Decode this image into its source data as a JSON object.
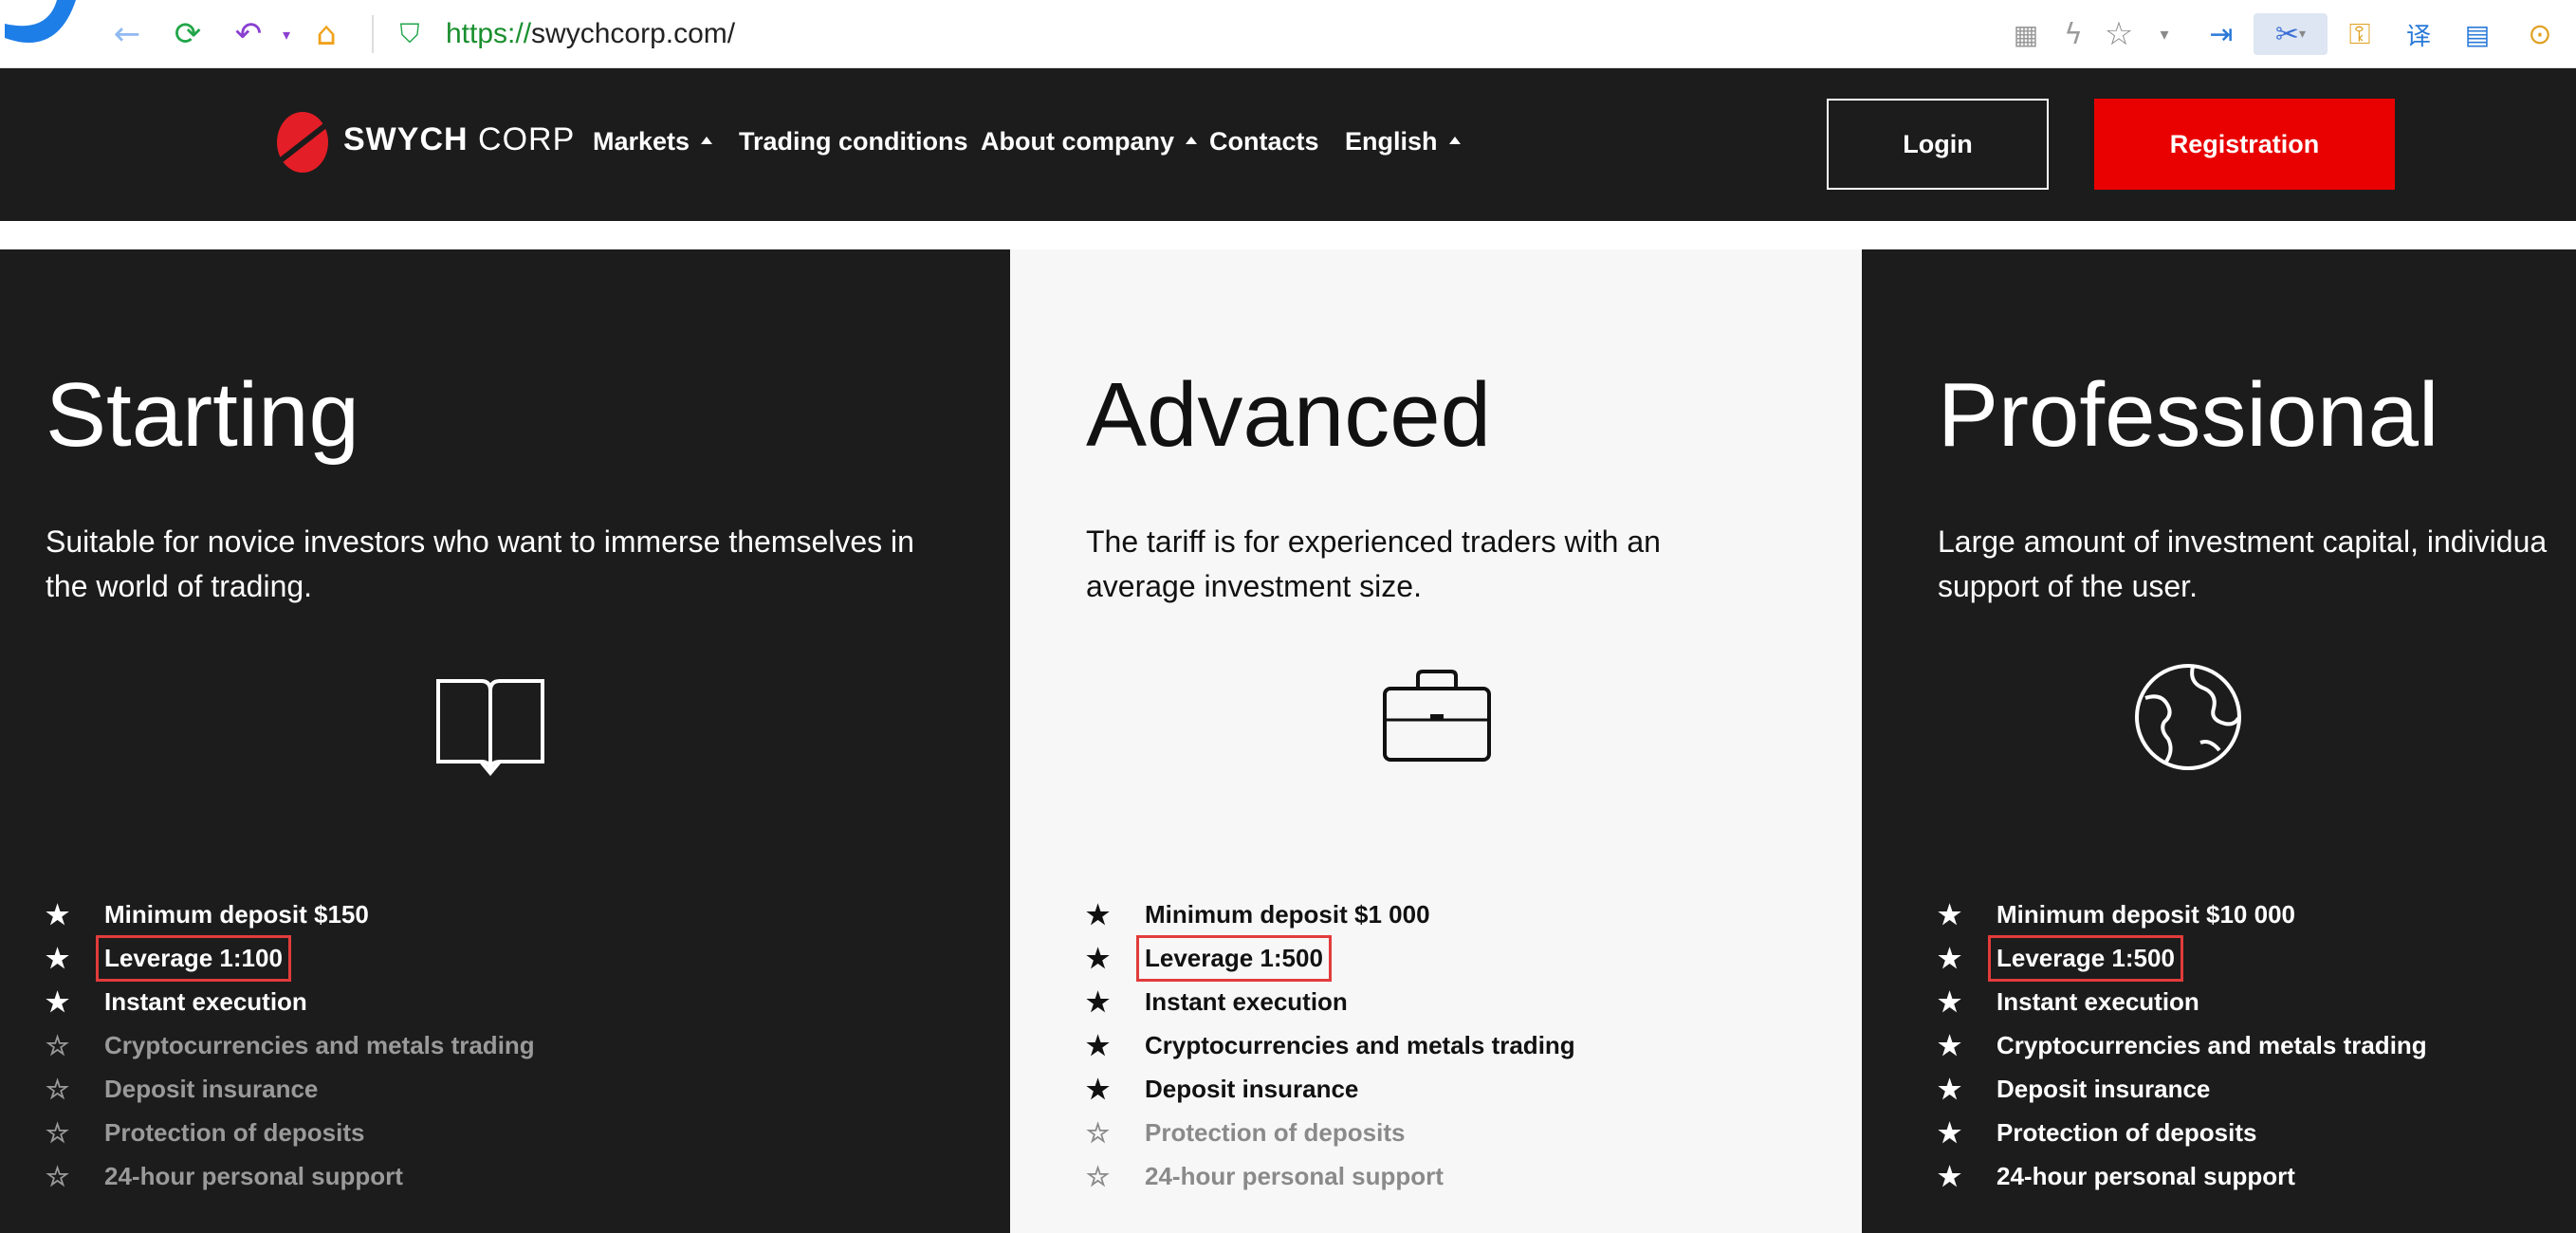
{
  "browser": {
    "url_scheme": "https://",
    "url_rest": "swychcorp.com/",
    "icons": [
      "browser-logo-icon",
      "back-icon",
      "reload-icon",
      "undo-icon",
      "home-icon",
      "shield-icon",
      "qr-icon",
      "lightning-icon",
      "star-icon",
      "dropdown-icon",
      "login-arrow-icon",
      "scissors-icon",
      "key-icon",
      "translate-icon",
      "reader-icon",
      "more-icon"
    ]
  },
  "header": {
    "logo_bold": "SWYCH",
    "logo_light": " CORP",
    "nav": [
      {
        "label": "Markets",
        "caret": true
      },
      {
        "label": "Trading conditions",
        "caret": false
      },
      {
        "label": "About company",
        "caret": true
      },
      {
        "label": "Contacts",
        "caret": false
      },
      {
        "label": "English",
        "caret": true
      }
    ],
    "login_label": "Login",
    "registration_label": "Registration"
  },
  "plans": [
    {
      "title": "Starting",
      "description": "Suitable for novice investors who want to immerse themselves in the world of trading.",
      "icon": "book-icon",
      "features": [
        {
          "label": "Minimum deposit  $150",
          "included": true
        },
        {
          "label": "Leverage 1:100",
          "included": true,
          "highlighted": true
        },
        {
          "label": "Instant execution",
          "included": true
        },
        {
          "label": "Cryptocurrencies and metals trading",
          "included": false
        },
        {
          "label": "Deposit insurance",
          "included": false
        },
        {
          "label": "Protection of deposits",
          "included": false
        },
        {
          "label": "24-hour personal support",
          "included": false
        }
      ]
    },
    {
      "title": "Advanced",
      "description": "The tariff is for experienced traders with an average investment size.",
      "icon": "briefcase-icon",
      "features": [
        {
          "label": "Minimum deposit  $1 000",
          "included": true
        },
        {
          "label": "Leverage 1:500",
          "included": true,
          "highlighted": true
        },
        {
          "label": "Instant execution",
          "included": true
        },
        {
          "label": "Cryptocurrencies and metals trading",
          "included": true
        },
        {
          "label": "Deposit insurance",
          "included": true
        },
        {
          "label": "Protection of deposits",
          "included": false
        },
        {
          "label": "24-hour personal support",
          "included": false
        }
      ]
    },
    {
      "title": "Professional",
      "description": "Large amount of investment capital, individua support of the user.",
      "icon": "globe-icon",
      "features": [
        {
          "label": "Minimum deposit  $10 000",
          "included": true
        },
        {
          "label": "Leverage 1:500",
          "included": true,
          "highlighted": true
        },
        {
          "label": "Instant execution",
          "included": true
        },
        {
          "label": "Cryptocurrencies and metals trading",
          "included": true
        },
        {
          "label": "Deposit insurance",
          "included": true
        },
        {
          "label": "Protection of deposits",
          "included": true
        },
        {
          "label": "24-hour personal support",
          "included": true
        }
      ]
    }
  ],
  "colors": {
    "accent": "#e90000",
    "dark": "#1c1c1c",
    "light": "#f7f7f7",
    "highlight": "#e23b3b"
  }
}
